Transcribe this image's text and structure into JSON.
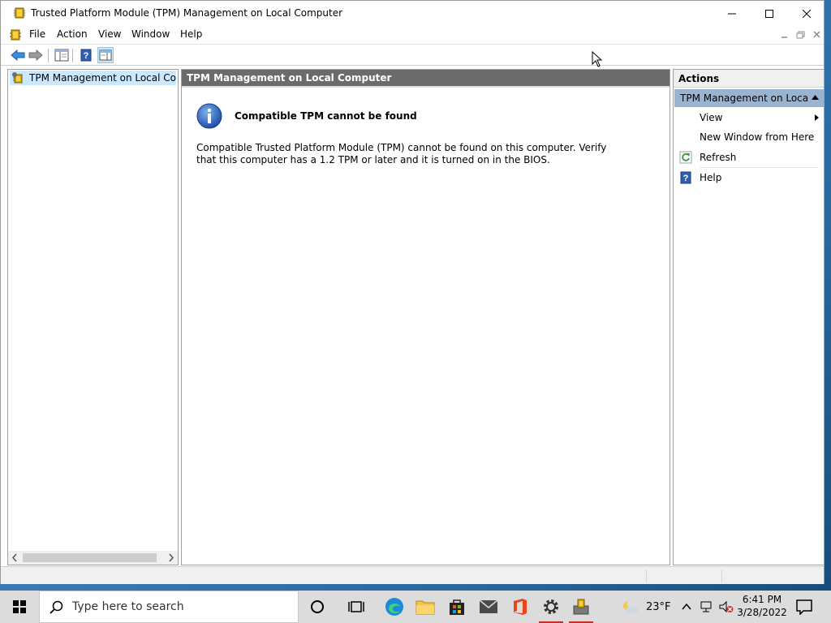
{
  "window": {
    "title": "Trusted Platform Module (TPM) Management on Local Computer"
  },
  "menubar": {
    "items": [
      {
        "label": "File"
      },
      {
        "label": "Action"
      },
      {
        "label": "View"
      },
      {
        "label": "Window"
      },
      {
        "label": "Help"
      }
    ]
  },
  "tree": {
    "item_label": "TPM Management on Local Comp"
  },
  "main": {
    "header_title": "TPM Management on Local Computer",
    "message_title": "Compatible TPM cannot be found",
    "message_body": "Compatible Trusted Platform Module (TPM) cannot be found on this computer. Verify that this computer has a 1.2 TPM or later and it is turned on in the BIOS."
  },
  "actions": {
    "title": "Actions",
    "section_label": "TPM Management on Loca...",
    "items": [
      {
        "label": "View",
        "icon": "none",
        "has_submenu": true
      },
      {
        "label": "New Window from Here",
        "icon": "none"
      },
      {
        "label": "Refresh",
        "icon": "refresh-icon"
      },
      {
        "label": "Help",
        "icon": "help-icon"
      }
    ]
  },
  "taskbar": {
    "search_placeholder": "Type here to search",
    "weather_temp": "23°F",
    "clock_time": "6:41 PM",
    "clock_date": "3/28/2022"
  },
  "colors": {
    "header_bar": "#6b6b6b",
    "selection": "#cce8ff",
    "actions_section": "#99b4d1",
    "taskbar": "#dcdcdc",
    "running_indicator": "#c4302b"
  }
}
